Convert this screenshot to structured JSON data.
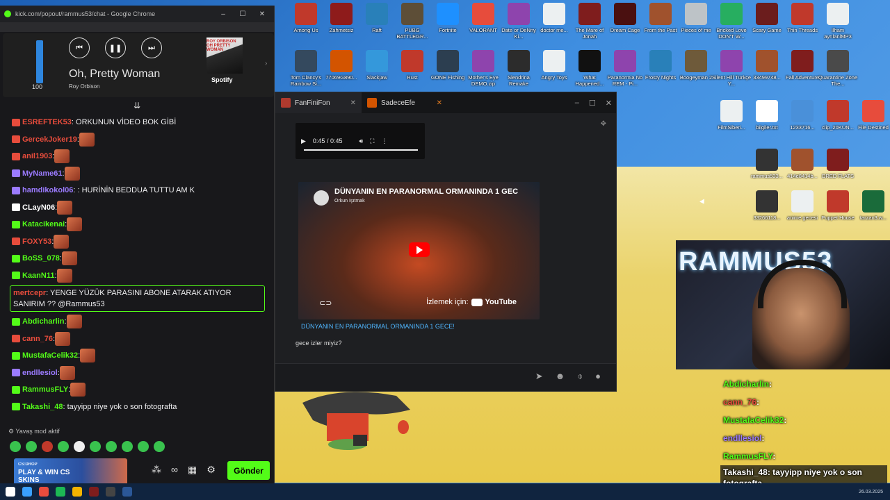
{
  "browser": {
    "title": "kick.com/popout/rammus53/chat - Google Chrome"
  },
  "spotify": {
    "song": "Oh, Pretty Woman",
    "artist": "Roy Orbison",
    "volume": "100",
    "volume_fraction": 1.0,
    "brand": "Spotify",
    "album_text": "ROY ORBISON OH PRETTY WOMAN"
  },
  "chat": {
    "messages": [
      {
        "user": "ESREFTEK53",
        "text": ": ORKUNUN VİDEO BOK GİBİ",
        "color": "#e74c3c"
      },
      {
        "user": "GercekJoker19",
        "text": ":",
        "color": "#e74c3c"
      },
      {
        "user": "anil1903",
        "text": ":",
        "color": "#e74c3c"
      },
      {
        "user": "MyName61",
        "text": ":",
        "color": "#9b7bff"
      },
      {
        "user": "hamdikokol06",
        "text": ": : HURİNİN BEDDUA TUTTU AM K",
        "color": "#9b7bff"
      },
      {
        "user": "CLayN06",
        "text": ":",
        "color": "#ffffff"
      },
      {
        "user": "Katacikenai",
        "text": ":",
        "color": "#53fc18"
      },
      {
        "user": "FOXY53",
        "text": ":",
        "color": "#e74c3c"
      },
      {
        "user": "BoSS_078",
        "text": ":",
        "color": "#53fc18"
      },
      {
        "user": "KaanN11",
        "text": ":",
        "color": "#53fc18"
      }
    ],
    "highlight": {
      "user": "mertcepr",
      "text": ": YENGE YÜZÜK PARASINI ABONE ATARAK ATIYOR SANIRIM ?? @Rammus53",
      "color": "#e74c3c"
    },
    "messages2": [
      {
        "user": "Abdicharlin",
        "text": ":",
        "color": "#53fc18"
      },
      {
        "user": "cann_76",
        "text": ":",
        "color": "#e74c3c"
      },
      {
        "user": "MustafaCelik32",
        "text": ":",
        "color": "#53fc18"
      },
      {
        "user": "endllesiol",
        "text": ":",
        "color": "#9b7bff"
      },
      {
        "user": "RammusFLY",
        "text": ":",
        "color": "#53fc18"
      },
      {
        "user": "Takashi_48",
        "text": ": tayyipp niye yok o son fotografta",
        "color": "#53fc18"
      }
    ],
    "slow_mode": "Yavaş mod aktif",
    "send_label": "Gönder",
    "ad": {
      "title": "PLAY & WIN CS SKINS",
      "brand": "CS:DROP"
    }
  },
  "messenger": {
    "tabs": [
      {
        "label": "FanFiniFon"
      },
      {
        "label": "SadeceEfe"
      }
    ],
    "audio_time": "0:45 / 0:45",
    "video_title": "DÜNYANIN EN PARANORMAL ORMANINDA 1 GEC",
    "video_channel": "Orkun Işıtmak",
    "watch_on": "İzlemek için:",
    "youtube": "YouTube",
    "video_caption": "DÜNYANIN EN PARANORMAL ORMANINDA 1 GECE!",
    "message_text": "gece izler miyiz?"
  },
  "webcam": {
    "neon": "RAMMUS53"
  },
  "overlay_chat": [
    {
      "user": "Abdicharlin",
      "text": ":",
      "color": "#53fc18"
    },
    {
      "user": "cann_76",
      "text": ":",
      "color": "#e74c3c"
    },
    {
      "user": "MustafaCelik32",
      "text": ":",
      "color": "#53fc18"
    },
    {
      "user": "endllesiol",
      "text": ":",
      "color": "#9b7bff"
    },
    {
      "user": "RammusFLY",
      "text": ":",
      "color": "#53fc18"
    }
  ],
  "overlay_ticker": "Takashi_48: tayyipp niye yok o son fotografta",
  "desktop_icons": [
    {
      "label": "Among Us",
      "color": "#c0392b"
    },
    {
      "label": "Zahmetsiz",
      "color": "#8e1b1b"
    },
    {
      "label": "Raft",
      "color": "#2980b9"
    },
    {
      "label": "PUBG BATTLEGR...",
      "color": "#5d4e37"
    },
    {
      "label": "Fortnite",
      "color": "#1e90ff"
    },
    {
      "label": "VALORANT",
      "color": "#e74c3c"
    },
    {
      "label": "Date or DeNny Ki...",
      "color": "#8e44ad"
    },
    {
      "label": "doctor me...",
      "color": "#ecf0f1"
    },
    {
      "label": "The Mare of Jonah",
      "color": "#7f1d1d"
    },
    {
      "label": "Dream Cage",
      "color": "#4a1010"
    },
    {
      "label": "From the Past",
      "color": "#a0522d"
    },
    {
      "label": "Pieces of me",
      "color": "#bdc3c7"
    },
    {
      "label": "Bricked Love DON'T W...",
      "color": "#27ae60"
    },
    {
      "label": "Scary Game",
      "color": "#6b1d1d"
    },
    {
      "label": "Thin Threads",
      "color": "#c0392b"
    },
    {
      "label": "Ilham ayrılanlMP3",
      "color": "#ecf0f1"
    },
    {
      "label": "Tom Clancy's Rainbow Si...",
      "color": "#34495e"
    },
    {
      "label": "77069G890...",
      "color": "#d35400"
    },
    {
      "label": "Slackjaw",
      "color": "#3498db"
    },
    {
      "label": "Rust",
      "color": "#c0392b"
    },
    {
      "label": "GONE Fishing",
      "color": "#2c3e50"
    },
    {
      "label": "Mother's Eye DEMO.zip",
      "color": "#8e44ad"
    },
    {
      "label": "Slendrina Remake",
      "color": "#2c2c2c"
    },
    {
      "label": "Angry Toys",
      "color": "#ecf0f1"
    },
    {
      "label": "What Happened...",
      "color": "#111111"
    },
    {
      "label": "Paranormia No REM - Pi...",
      "color": "#8e44ad"
    },
    {
      "label": "Frosty Nights",
      "color": "#2980b9"
    },
    {
      "label": "Boogeyman 2",
      "color": "#6e5a3a"
    },
    {
      "label": "Silent Hill Türkçe Y...",
      "color": "#8e44ad"
    },
    {
      "label": "33499748...",
      "color": "#a0522d"
    },
    {
      "label": "Fall Adventure",
      "color": "#7f1d1d"
    },
    {
      "label": "Quarantine Zone The...",
      "color": "#4a4a4a"
    },
    {
      "label": "FilmSiberi...",
      "color": "#ecf0f1"
    },
    {
      "label": "bilgiler.txt",
      "color": "#ffffff"
    },
    {
      "label": "1233716...",
      "color": "#4a90d9"
    },
    {
      "label": "clip_20KUN...",
      "color": "#c0392b"
    },
    {
      "label": "File Destined",
      "color": "#e74c3c"
    },
    {
      "label": "rammus533...",
      "color": "#333333"
    },
    {
      "label": "414e8414b...",
      "color": "#a0522d"
    },
    {
      "label": "DRED FLATS",
      "color": "#7f1d1d"
    },
    {
      "label": "33266118...",
      "color": "#333333"
    },
    {
      "label": "anime gecesi",
      "color": "#ecf0f1"
    },
    {
      "label": "Puppet House",
      "color": "#c0392b"
    },
    {
      "label": "tarzan3.w...",
      "color": "#1a6b3a"
    }
  ],
  "taskbar": {
    "date": "26.03.2025"
  }
}
